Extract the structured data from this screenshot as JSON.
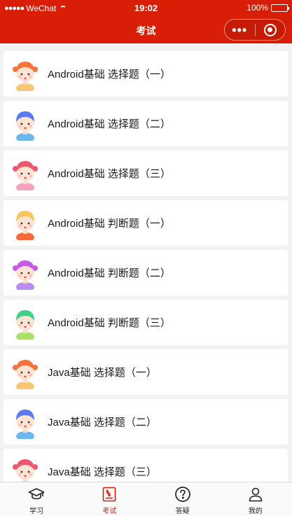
{
  "status": {
    "signal_dots": "●●●●●",
    "carrier": "WeChat",
    "time": "19:02",
    "battery": "100%"
  },
  "nav": {
    "title": "考试",
    "more_icon": "more-dots-icon",
    "close_icon": "target-circle-icon"
  },
  "colors": {
    "brand": "#d81e06",
    "active_tab": "#d81e06"
  },
  "exams": [
    {
      "title": "Android基础 选择题（一）",
      "avatar": {
        "icon": "girl-avatar-icon",
        "hair": "#f4743b",
        "shirt": "#f7c873"
      }
    },
    {
      "title": "Android基础 选择题（二）",
      "avatar": {
        "icon": "boy-avatar-icon",
        "hair": "#5a7cf0",
        "shirt": "#6ab8ee"
      }
    },
    {
      "title": "Android基础 选择题（三）",
      "avatar": {
        "icon": "girl-avatar-icon",
        "hair": "#f0566e",
        "shirt": "#f7a1c0"
      }
    },
    {
      "title": "Android基础 判断题（一）",
      "avatar": {
        "icon": "boy-avatar-icon",
        "hair": "#f7c55e",
        "shirt": "#f46a3a"
      }
    },
    {
      "title": "Android基础 判断题（二）",
      "avatar": {
        "icon": "girl-avatar-icon",
        "hair": "#c65ce6",
        "shirt": "#b98cf0"
      }
    },
    {
      "title": "Android基础 判断题（三）",
      "avatar": {
        "icon": "boy-avatar-icon",
        "hair": "#3fd18a",
        "shirt": "#a8e06a"
      }
    },
    {
      "title": "Java基础 选择题（一）",
      "avatar": {
        "icon": "girl-avatar-icon",
        "hair": "#f4743b",
        "shirt": "#f7c873"
      }
    },
    {
      "title": "Java基础 选择题（二）",
      "avatar": {
        "icon": "boy-avatar-icon",
        "hair": "#5a7cf0",
        "shirt": "#6ab8ee"
      }
    },
    {
      "title": "Java基础 选择题（三）",
      "avatar": {
        "icon": "girl-avatar-icon",
        "hair": "#f0566e",
        "shirt": "#f7a1c0"
      }
    }
  ],
  "tabs": [
    {
      "label": "学习",
      "icon": "graduation-cap-icon",
      "active": false
    },
    {
      "label": "考试",
      "icon": "exam-paper-icon",
      "active": true
    },
    {
      "label": "答疑",
      "icon": "question-circle-icon",
      "active": false
    },
    {
      "label": "我的",
      "icon": "user-icon",
      "active": false
    }
  ]
}
